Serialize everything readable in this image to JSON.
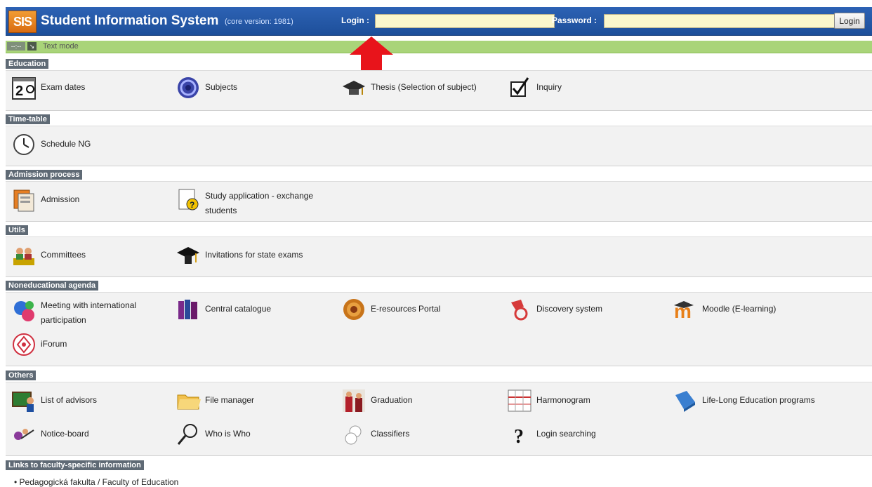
{
  "header": {
    "logo_text": "SIS",
    "title": "Student Information System",
    "version": "(core version: 1981)",
    "login_label": "Login :",
    "login_value": "",
    "password_label": "Password :",
    "password_value": "",
    "login_button": "Login"
  },
  "toolbar": {
    "dash": "--:--",
    "icon": "↘",
    "text_mode": "Text mode"
  },
  "sections": {
    "education": {
      "title": "Education",
      "items": [
        "Exam dates",
        "Subjects",
        "Thesis (Selection of subject)",
        "Inquiry"
      ]
    },
    "timetable": {
      "title": "Time-table",
      "items": [
        "Schedule NG"
      ]
    },
    "admission": {
      "title": "Admission process",
      "items": [
        "Admission",
        "Study application - exchange students"
      ]
    },
    "utils": {
      "title": "Utils",
      "items": [
        "Committees",
        "Invitations for state exams"
      ]
    },
    "noneducational": {
      "title": "Noneducational agenda",
      "items": [
        "Meeting with international participation",
        "Central catalogue",
        "E-resources Portal",
        "Discovery system",
        "Moodle (E-learning)",
        "iForum"
      ]
    },
    "others": {
      "title": "Others",
      "items": [
        "List of advisors",
        "File manager",
        "Graduation",
        "Harmonogram",
        "Life-Long Education programs",
        "Notice-board",
        "Who is Who",
        "Classifiers",
        "Login searching"
      ]
    },
    "links": {
      "title": "Links to faculty-specific information",
      "items": [
        "Pedagogická fakulta / Faculty of Education"
      ]
    }
  },
  "colors": {
    "header_blue": "#2d62b4",
    "toolbar_green": "#a9d479",
    "section_title_gray": "#5f6a75",
    "arrow_red": "#e8141b"
  }
}
